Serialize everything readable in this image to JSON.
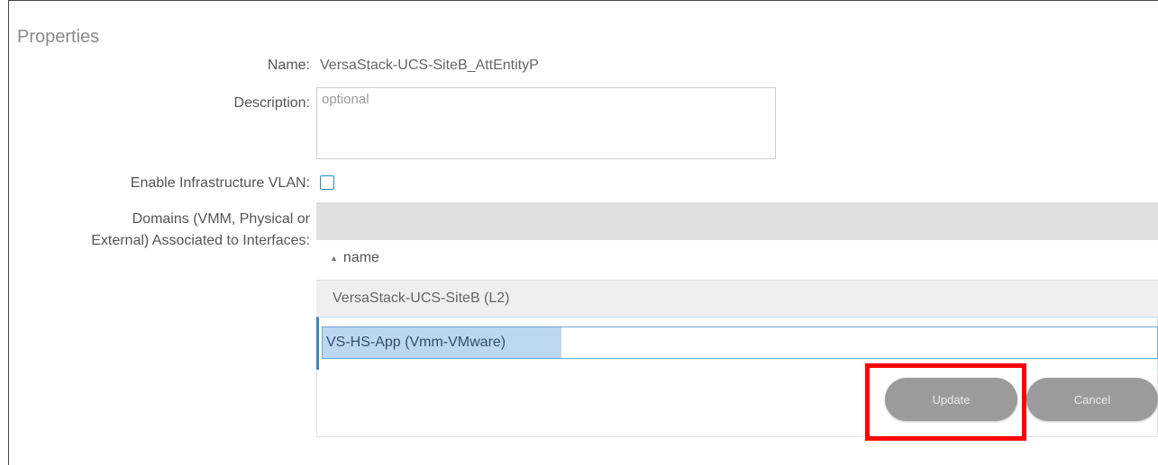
{
  "panel": {
    "title": "Properties"
  },
  "fields": {
    "name_label": "Name:",
    "name_value": "VersaStack-UCS-SiteB_AttEntityP",
    "description_label": "Description:",
    "description_placeholder": "optional",
    "infra_vlan_label": "Enable Infrastructure VLAN:",
    "infra_vlan_checked": false,
    "domains_label_line1": "Domains (VMM, Physical or",
    "domains_label_line2": "External) Associated to Interfaces:"
  },
  "domains_table": {
    "columns": [
      "name"
    ],
    "sort_icon": "sort-ascending-icon",
    "rows": [
      {
        "name": "VersaStack-UCS-SiteB (L2)"
      }
    ],
    "editing_row_value": "VS-HS-App (Vmm-VMware)"
  },
  "actions": {
    "update_label": "Update",
    "cancel_label": "Cancel"
  },
  "colors": {
    "highlight": "#ff0000",
    "button_bg": "#9b9b9b",
    "edit_accent": "#3a86c4"
  }
}
